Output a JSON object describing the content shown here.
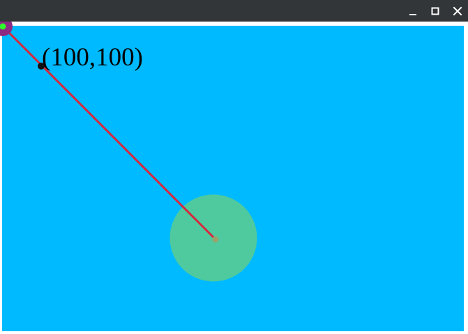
{
  "window": {
    "controls": {
      "minimize_icon": "minimize-icon",
      "maximize_icon": "maximize-icon",
      "close_icon": "close-icon"
    }
  },
  "scene": {
    "background_color": "#00BAFF",
    "coordinate_label": "(100,100)",
    "colors": {
      "titlebar": "#323639",
      "line": "#D6283C",
      "large_circle": "#4FCA9E",
      "large_circle_center": "#9AA36B",
      "corner_circle": "#8F2A82",
      "corner_dot": "#2CFF2C",
      "marker": "#111111",
      "label": "#000000"
    }
  }
}
